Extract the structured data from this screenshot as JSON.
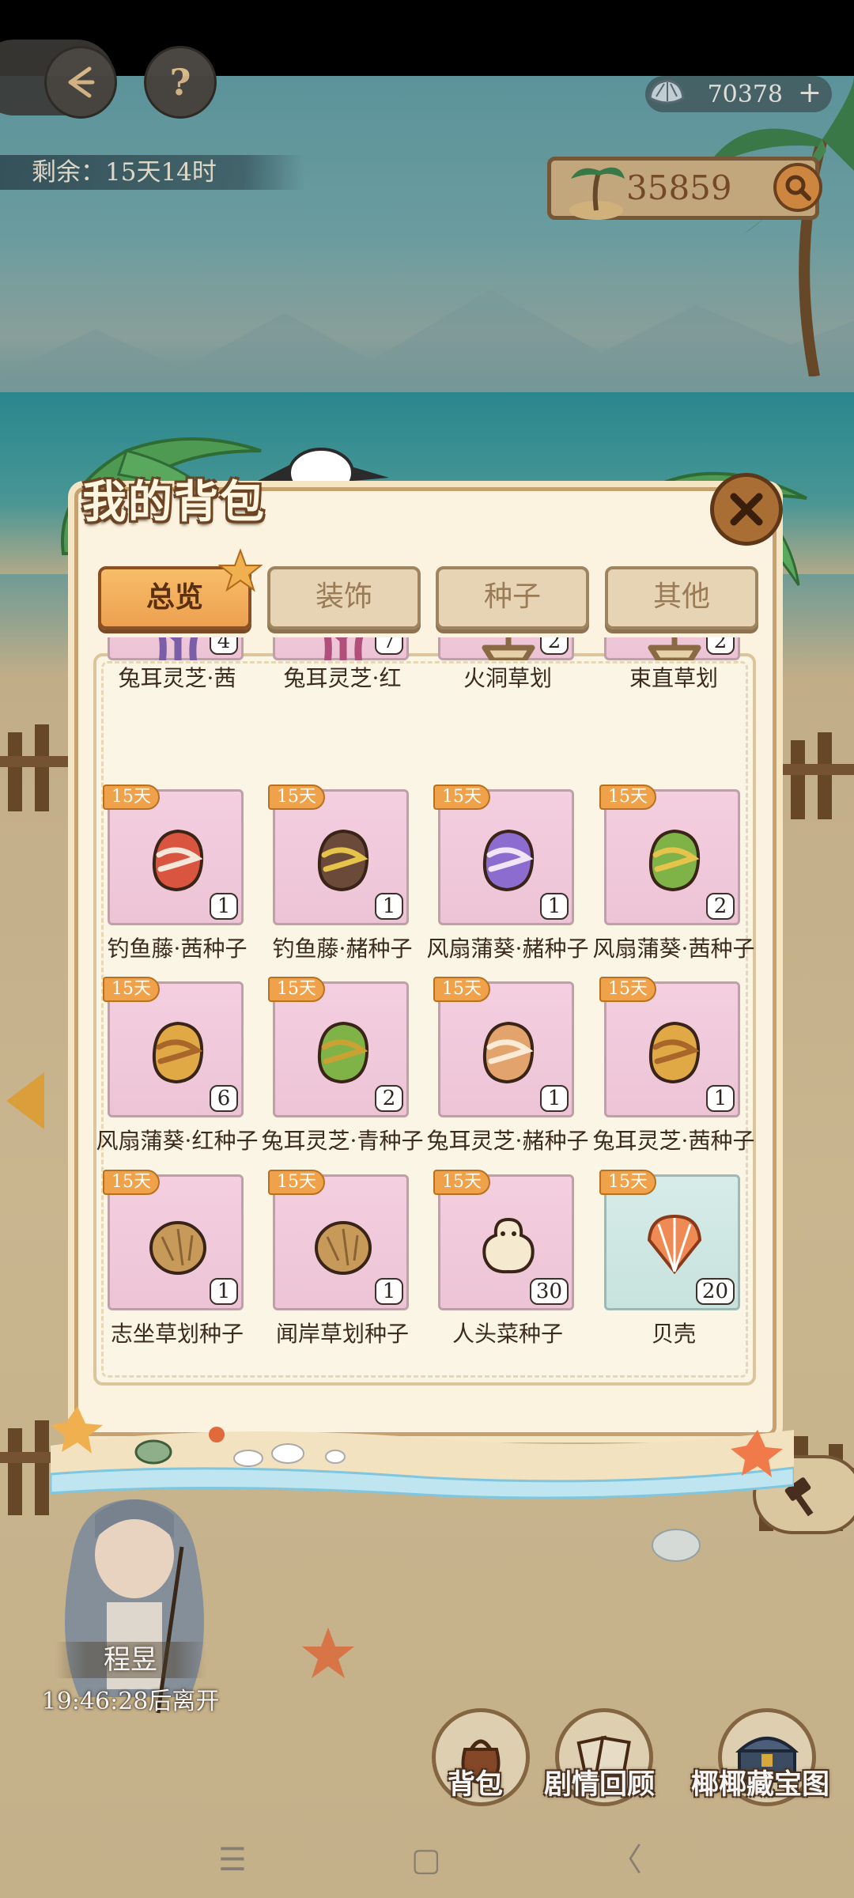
{
  "hud": {
    "remain_text": "剩余：15天14时",
    "shell_count": "70378",
    "plus": "+",
    "coin_count": "35859",
    "help": "?"
  },
  "panel": {
    "title": "我的背包",
    "tabs": [
      {
        "label": "总览",
        "active": true
      },
      {
        "label": "装饰",
        "active": false
      },
      {
        "label": "种子",
        "active": false
      },
      {
        "label": "其他",
        "active": false
      }
    ],
    "items": [
      {
        "name": "兔耳灵芝·茜",
        "count": "4",
        "badge": "",
        "icon": "coral-icon",
        "color": "#7a5fa8"
      },
      {
        "name": "兔耳灵芝·红",
        "count": "7",
        "badge": "",
        "icon": "coral-icon",
        "color": "#b0507a"
      },
      {
        "name": "火洞草划",
        "count": "2",
        "badge": "",
        "icon": "boat-icon",
        "color": "#8a6a45"
      },
      {
        "name": "束直草划",
        "count": "2",
        "badge": "",
        "icon": "boat-icon",
        "color": "#8a6a45"
      },
      {
        "name": "钓鱼藤·茜种子",
        "count": "1",
        "badge": "15天",
        "icon": "seed-icon",
        "color": "#d9553f",
        "stripe": "#f4e6d8"
      },
      {
        "name": "钓鱼藤·赭种子",
        "count": "1",
        "badge": "15天",
        "icon": "seed-icon",
        "color": "#6b4a3a",
        "stripe": "#e6c34a"
      },
      {
        "name": "风扇蒲葵·赭种子",
        "count": "1",
        "badge": "15天",
        "icon": "seed-icon",
        "color": "#8d6cd0",
        "stripe": "#f0e4f6"
      },
      {
        "name": "风扇蒲葵·茜种子",
        "count": "2",
        "badge": "15天",
        "icon": "seed-icon",
        "color": "#7fb347",
        "stripe": "#e6c34a"
      },
      {
        "name": "风扇蒲葵·红种子",
        "count": "6",
        "badge": "15天",
        "icon": "seed-icon",
        "color": "#e0a945",
        "stripe": "#a8662a"
      },
      {
        "name": "兔耳灵芝·青种子",
        "count": "2",
        "badge": "15天",
        "icon": "seed-icon",
        "color": "#7fb347",
        "stripe": "#c9a233"
      },
      {
        "name": "兔耳灵芝·赭种子",
        "count": "1",
        "badge": "15天",
        "icon": "seed-icon",
        "color": "#e2a46c",
        "stripe": "#fbead6"
      },
      {
        "name": "兔耳灵芝·茜种子",
        "count": "1",
        "badge": "15天",
        "icon": "seed-icon",
        "color": "#e0a945",
        "stripe": "#a8662a"
      },
      {
        "name": "志坐草划种子",
        "count": "1",
        "badge": "15天",
        "icon": "coconut-icon",
        "color": "#c79a5a"
      },
      {
        "name": "闻岸草划种子",
        "count": "1",
        "badge": "15天",
        "icon": "coconut-icon",
        "color": "#c79a5a"
      },
      {
        "name": "人头菜种子",
        "count": "30",
        "badge": "15天",
        "icon": "bulb-icon",
        "color": "#f5ead0"
      },
      {
        "name": "贝壳",
        "count": "20",
        "badge": "15天",
        "icon": "shell-icon",
        "color": "#f08a55",
        "slot": "blue"
      }
    ]
  },
  "character": {
    "name": "程昱",
    "timer": "19:46:28后离开"
  },
  "bottom_menu": [
    {
      "label": "背包",
      "icon": "bag-icon"
    },
    {
      "label": "剧情回顾",
      "icon": "story-icon"
    },
    {
      "label": "椰椰藏宝图",
      "icon": "treasure-icon"
    }
  ],
  "nav": {
    "menu": "☰",
    "home": "▢",
    "back": "〈"
  }
}
